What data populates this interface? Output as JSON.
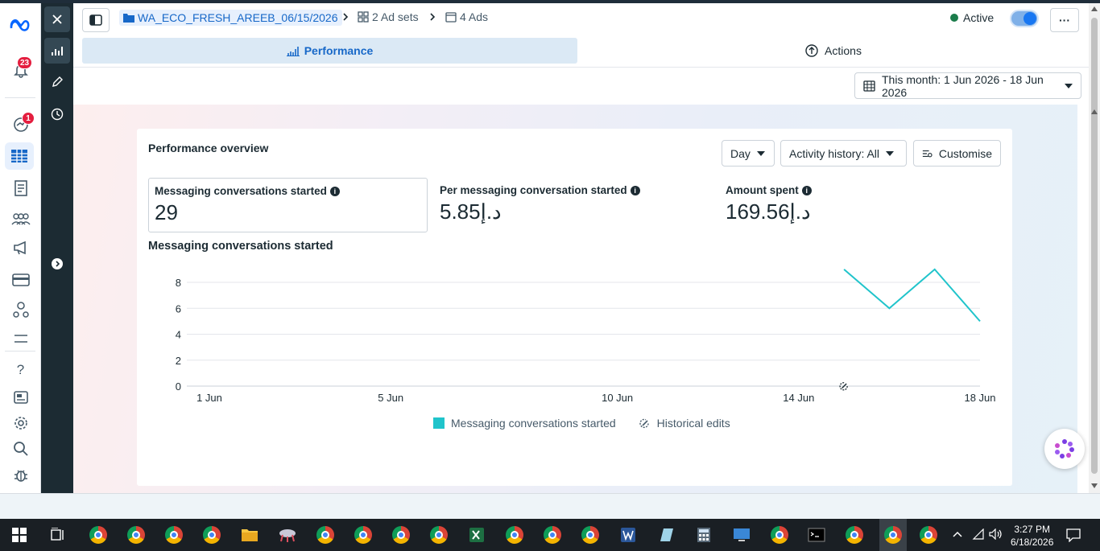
{
  "header": {
    "campaign_name": "WA_ECO_FRESH_AREEB_06/15/2026",
    "ad_sets": "2 Ad sets",
    "ads": "4 Ads",
    "status": "Active",
    "more": "···"
  },
  "tabs": {
    "performance": "Performance",
    "actions": "Actions"
  },
  "date_range": "This month: 1 Jun 2026 - 18 Jun 2026",
  "app_nav": {
    "notifications_badge": "23",
    "messages_badge": "1"
  },
  "overview": {
    "title": "Performance overview",
    "granularity": "Day",
    "activity_history": "Activity history: All",
    "customise": "Customise"
  },
  "metrics": [
    {
      "label": "Messaging conversations started",
      "value": "29"
    },
    {
      "label": "Per messaging conversation started",
      "value": "5.85د.إ"
    },
    {
      "label": "Amount spent",
      "value": "169.56د.إ"
    }
  ],
  "chart_data": {
    "type": "line",
    "title": "Messaging conversations started",
    "x_tick_labels": [
      "1 Jun",
      "5 Jun",
      "10 Jun",
      "14 Jun",
      "18 Jun"
    ],
    "x_tick_days": [
      1,
      5,
      10,
      14,
      18
    ],
    "y_ticks": [
      0,
      2,
      4,
      6,
      8
    ],
    "ylim": [
      0,
      8.8
    ],
    "xlim": [
      1,
      18
    ],
    "series": [
      {
        "name": "Messaging conversations started",
        "color": "#20c4cb",
        "x": [
          15,
          16,
          17,
          18
        ],
        "y": [
          9,
          6,
          9,
          5
        ]
      }
    ],
    "historical_edit_day": 15,
    "legend": [
      "Messaging conversations started",
      "Historical edits"
    ],
    "grid": true
  },
  "clock": {
    "time": "3:27 PM",
    "date": "6/18/2026"
  }
}
